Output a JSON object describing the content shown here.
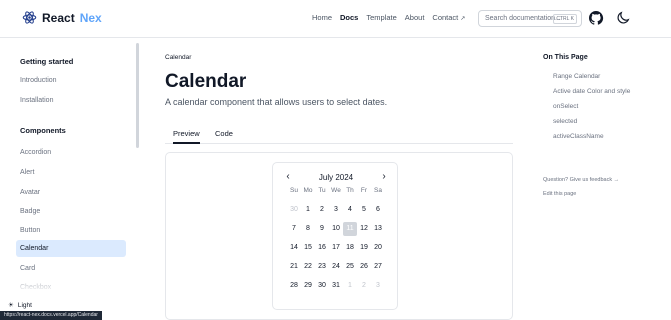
{
  "header": {
    "brand_name": "React",
    "brand_accent": "Nex",
    "nav": [
      {
        "label": "Home"
      },
      {
        "label": "Docs"
      },
      {
        "label": "Template"
      },
      {
        "label": "About"
      },
      {
        "label": "Contact"
      }
    ],
    "contact_icon": "external-link-icon",
    "search_placeholder": "Search documentation...",
    "search_shortcut": "CTRL K",
    "icons": [
      "github-icon",
      "moon-icon"
    ]
  },
  "sidebar": {
    "getting_started": "Getting started",
    "getting_started_items": [
      "Introduction",
      "Installation"
    ],
    "components": "Components",
    "component_items": [
      "Accordion",
      "Alert",
      "Avatar",
      "Badge",
      "Button",
      "Calendar",
      "Card",
      "Checkbox"
    ],
    "active_item": "Calendar",
    "theme_label": "Light",
    "theme_icon": "sun-icon",
    "status_url": "https://react-nex.docs.vercel.app/Calendar"
  },
  "main": {
    "breadcrumb": "Calendar",
    "title": "Calendar",
    "description": "A calendar component that allows users to select dates.",
    "tabs": [
      {
        "label": "Preview",
        "active": true
      },
      {
        "label": "Code",
        "active": false
      }
    ]
  },
  "calendar": {
    "month_label": "July 2024",
    "prev_icon": "chevron-left-icon",
    "next_icon": "chevron-right-icon",
    "weekdays": [
      "Su",
      "Mo",
      "Tu",
      "We",
      "Th",
      "Fr",
      "Sa"
    ],
    "days": [
      "30",
      "1",
      "2",
      "3",
      "4",
      "5",
      "6",
      "7",
      "8",
      "9",
      "10",
      "11",
      "12",
      "13",
      "14",
      "15",
      "16",
      "17",
      "18",
      "19",
      "20",
      "21",
      "22",
      "23",
      "24",
      "25",
      "26",
      "27",
      "28",
      "29",
      "30",
      "31",
      "1",
      "2",
      "3"
    ],
    "highlighted_day": "11",
    "highlight_color": "#d1d5db"
  },
  "toc": {
    "title": "On This Page",
    "items": [
      "Range Calendar",
      "Active date Color and style",
      "onSelect",
      "selected",
      "activeClassName"
    ],
    "feedback": "Question? Give us feedback →",
    "edit": "Edit this page"
  },
  "colors": {
    "active_sidebar_bg": "#dbeafe",
    "brand_accent": "#60a5fa"
  }
}
